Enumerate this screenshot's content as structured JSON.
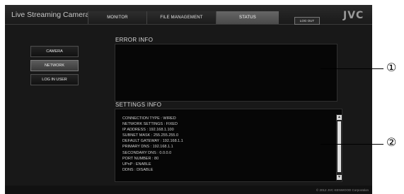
{
  "app": {
    "title": "Live Streaming Camera",
    "brand": "JVC"
  },
  "nav": {
    "tabs": [
      {
        "label": "MONITOR",
        "active": false
      },
      {
        "label": "FILE MANAGEMENT",
        "active": false
      },
      {
        "label": "STATUS",
        "active": true
      }
    ],
    "logout_label": "LOG OUT"
  },
  "sidebar": {
    "items": [
      {
        "label": "CAMERA",
        "active": false
      },
      {
        "label": "NETWORK",
        "active": true
      },
      {
        "label": "LOG IN USER",
        "active": false
      }
    ]
  },
  "error_info": {
    "title": "ERROR INFO"
  },
  "settings_info": {
    "title": "SETTINGS INFO",
    "lines": [
      "CONNECTION TYPE : WIRED",
      "NETWORK SETTINGS : FIXED",
      "IP ADDRESS : 192.168.1.100",
      "SUBNET MASK : 255.255.255.0",
      "DEFAULT GATEWAY : 192.168.1.1",
      "PRIMARY DNS : 192.168.1.1",
      "SECONDARY DNS : 0.0.0.0",
      "PORT NUMBER : 80",
      "UPnP : ENABLE",
      "DDNS : DISABLE"
    ]
  },
  "footer": {
    "copyright": "© 2012 JVC KENWOOD Corporation"
  },
  "callouts": [
    "①",
    "②"
  ],
  "colors": {
    "background": "#181818",
    "active_tab": "#5a5a5a",
    "panel": "#060606"
  }
}
